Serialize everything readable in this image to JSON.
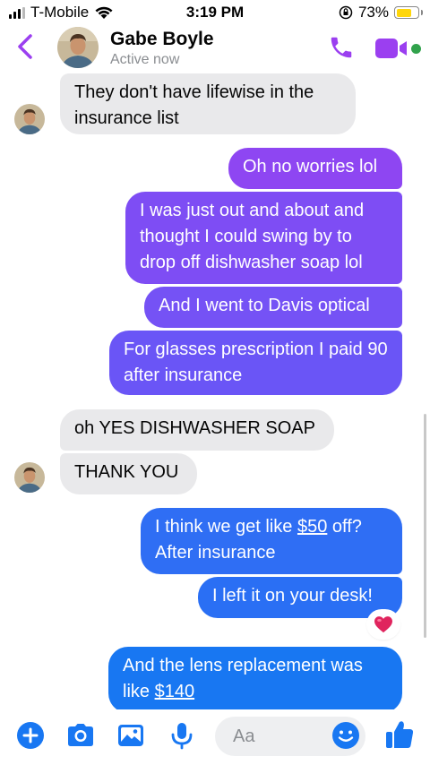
{
  "status_bar": {
    "carrier": "T-Mobile",
    "time": "3:19 PM",
    "battery": "73%",
    "battery_level": 0.73
  },
  "header": {
    "contact_name": "Gabe Boyle",
    "status": "Active now"
  },
  "messages": [
    {
      "side": "incoming",
      "text": "They don't have lifewise in the insurance list"
    },
    {
      "side": "outgoing",
      "text": "Oh no worries lol"
    },
    {
      "side": "outgoing",
      "text": "I was just out and about and thought I could swing by to drop off dishwasher soap lol"
    },
    {
      "side": "outgoing",
      "text": "And I went to Davis optical"
    },
    {
      "side": "outgoing",
      "text": "For glasses prescription I paid 90 after insurance"
    },
    {
      "side": "incoming",
      "text": "oh YES DISHWASHER SOAP"
    },
    {
      "side": "incoming",
      "text": "THANK YOU"
    },
    {
      "side": "outgoing",
      "text_before": "I think we get like ",
      "link": "$50",
      "text_after": " off? After insurance"
    },
    {
      "side": "outgoing",
      "text": "I left it on your desk!",
      "reaction": "heart"
    },
    {
      "side": "outgoing",
      "text_before": "And the lens replacement was like ",
      "link": "$140",
      "text_after": ""
    }
  ],
  "composer": {
    "placeholder": "Aa"
  },
  "icons": {
    "back": "chevron-left-icon",
    "call": "phone-icon",
    "video": "video-camera-icon",
    "add": "plus-circle-icon",
    "camera": "camera-icon",
    "gallery": "image-icon",
    "mic": "microphone-icon",
    "emoji": "smiley-icon",
    "like": "thumbs-up-icon"
  },
  "colors": {
    "accent_purple": "#9b3ff0",
    "accent_blue": "#1877f2",
    "bubble_incoming": "#e9e9eb",
    "online": "#31a24c",
    "heart": "#e0245e"
  }
}
